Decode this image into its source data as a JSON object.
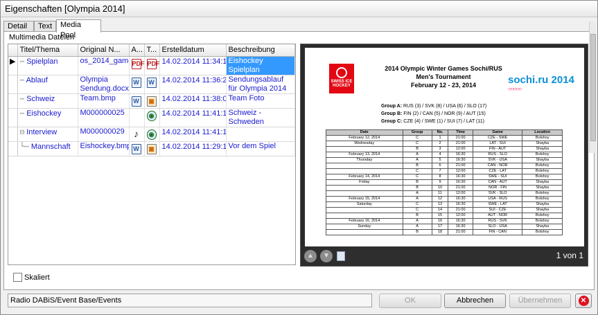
{
  "window": {
    "title": "Eigenschaften [Olympia 2014]"
  },
  "tabs": [
    {
      "label": "Detail"
    },
    {
      "label": "Text"
    },
    {
      "label": "Media Pool"
    }
  ],
  "media": {
    "group_label": "Multimedia Dateien",
    "columns": [
      "Titel/Thema",
      "Original N...",
      "A...",
      "T...",
      "Erstelldatum",
      "Beschreibung"
    ],
    "rows": [
      {
        "indicator": "▶",
        "tree": "⋯",
        "title": "Spielplan",
        "original": "os_2014_game_",
        "a_icon": "pdf",
        "t_icon": "pdf",
        "date": "14.02.2014 11:34:14",
        "desc": "Eishockey Spielplan",
        "selected": true
      },
      {
        "indicator": "",
        "tree": "⋯",
        "title": "Ablauf",
        "original": "Olympia Sendung.docx",
        "a_icon": "word",
        "t_icon": "word",
        "date": "14.02.2014 11:36:22",
        "desc": "Sendungsablauf für Olympia 2014"
      },
      {
        "indicator": "",
        "tree": "⋯",
        "title": "Schweiz",
        "original": "Team.bmp",
        "a_icon": "word",
        "t_icon": "img",
        "date": "14.02.2014 11:38:04",
        "desc": "Team Foto"
      },
      {
        "indicator": "",
        "tree": "⋯",
        "title": "Eishockey",
        "original": "M000000025",
        "a_icon": "",
        "t_icon": "net",
        "date": "14.02.2014 11:41:11",
        "desc": "Schweiz - Schweden"
      },
      {
        "indicator": "",
        "tree": "⊟",
        "title": "Interview",
        "original": "M000000029",
        "a_icon": "snd",
        "t_icon": "net",
        "date": "14.02.2014 11:41:11",
        "desc": ""
      },
      {
        "indicator": "",
        "tree": "└⋯",
        "title": "Mannschaft",
        "original": "Eishockey.bmp",
        "a_icon": "word",
        "t_icon": "img",
        "date": "14.02.2014 11:29:11",
        "desc": "Vor dem Spiel"
      }
    ]
  },
  "preview": {
    "doc_title_lines": [
      "2014 Olympic Winter Games Sochi/RUS",
      "Men's Tournament",
      "February 12 - 23, 2014"
    ],
    "swiss_logo_text": "SWISS ICE HOCKEY",
    "sochi_logo_text": "sochi.ru 2014",
    "groups": [
      {
        "label": "Group A:",
        "teams": "RUS (3) / SVK (8) / USA (6) / SLO (17)"
      },
      {
        "label": "Group B:",
        "teams": "FIN (2) / CAN (5) / NOR (9) / AUT (15)"
      },
      {
        "label": "Group C:",
        "teams": "CZE (4) / SWE (1) / SUI (7) / LAT (11)"
      }
    ],
    "schedule_headers": [
      "Date",
      "Group",
      "No.",
      "Time",
      "Game",
      "Location"
    ],
    "schedule": [
      {
        "date": "February 12, 2014",
        "group": "C",
        "no": "1",
        "time": "21:00",
        "game": "CZE - SWE",
        "loc": "Bolshoy"
      },
      {
        "date": "Wednesday",
        "group": "C",
        "no": "2",
        "time": "21:00",
        "game": "LAT - SUI",
        "loc": "Shayba"
      },
      {
        "date": "",
        "group": "B",
        "no": "3",
        "time": "12:00",
        "game": "FIN - AUT",
        "loc": "Shayba"
      },
      {
        "date": "February 13, 2014",
        "group": "A",
        "no": "4",
        "time": "16:30",
        "game": "RUS - SLO",
        "loc": "Bolshoy"
      },
      {
        "date": "Thursday",
        "group": "A",
        "no": "5",
        "time": "16:30",
        "game": "SVK - USA",
        "loc": "Shayba"
      },
      {
        "date": "",
        "group": "B",
        "no": "6",
        "time": "21:00",
        "game": "CAN - NOR",
        "loc": "Bolshoy"
      },
      {
        "date": "",
        "group": "C",
        "no": "7",
        "time": "12:00",
        "game": "CZE - LAT",
        "loc": "Bolshoy"
      },
      {
        "date": "February 14, 2014",
        "group": "C",
        "no": "8",
        "time": "16:30",
        "game": "SWE - SUI",
        "loc": "Bolshoy"
      },
      {
        "date": "Friday",
        "group": "B",
        "no": "9",
        "time": "16:30",
        "game": "CAN - AUT",
        "loc": "Shayba"
      },
      {
        "date": "",
        "group": "B",
        "no": "10",
        "time": "21:00",
        "game": "NOR - FIN",
        "loc": "Shayba"
      },
      {
        "date": "",
        "group": "A",
        "no": "11",
        "time": "12:00",
        "game": "SVK - SLO",
        "loc": "Bolshoy"
      },
      {
        "date": "February 15, 2014",
        "group": "A",
        "no": "12",
        "time": "16:30",
        "game": "USA - RUS",
        "loc": "Bolshoy"
      },
      {
        "date": "Saturday",
        "group": "C",
        "no": "13",
        "time": "16:30",
        "game": "SWE - LAT",
        "loc": "Shayba"
      },
      {
        "date": "",
        "group": "C",
        "no": "14",
        "time": "21:00",
        "game": "SUI - CZE",
        "loc": "Shayba"
      },
      {
        "date": "",
        "group": "B",
        "no": "15",
        "time": "12:00",
        "game": "AUT - NOR",
        "loc": "Bolshoy"
      },
      {
        "date": "February 16, 2014",
        "group": "A",
        "no": "16",
        "time": "16:30",
        "game": "RUS - SVK",
        "loc": "Bolshoy"
      },
      {
        "date": "Sunday",
        "group": "A",
        "no": "17",
        "time": "16:30",
        "game": "SLO - USA",
        "loc": "Shayba"
      },
      {
        "date": "",
        "group": "B",
        "no": "18",
        "time": "21:00",
        "game": "FIN - CAN",
        "loc": "Bolshoy"
      }
    ],
    "page_count": "1 von 1"
  },
  "options": {
    "scaled_label": "Skaliert"
  },
  "status": {
    "path": "Radio DABiS/Event Base/Events"
  },
  "buttons": {
    "ok": "OK",
    "cancel": "Abbrechen",
    "apply": "Übernehmen"
  }
}
